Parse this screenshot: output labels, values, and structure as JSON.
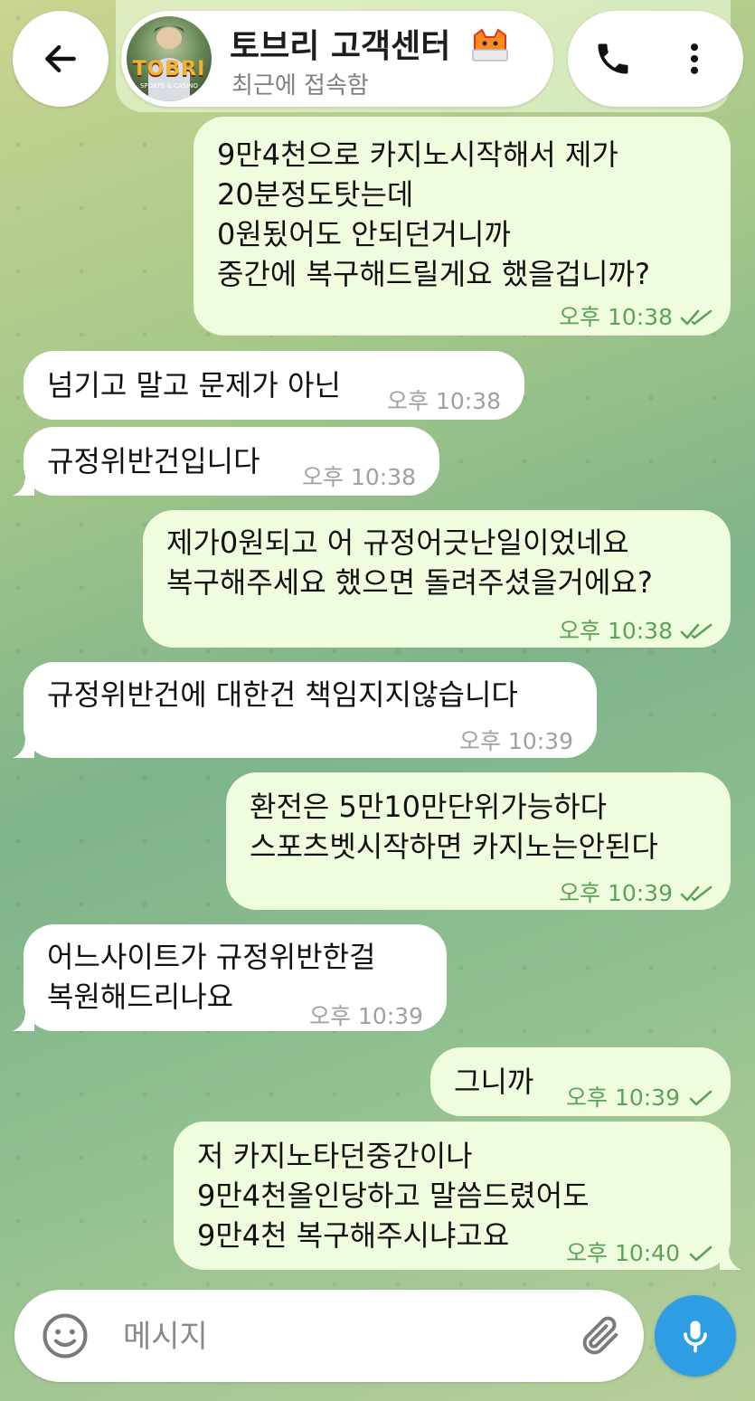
{
  "header": {
    "title": "토브리 고객센터",
    "status": "최근에 접속함",
    "avatar_text": "TOBRI",
    "avatar_sub": "SPORTS & CASINO"
  },
  "messages": [
    {
      "dir": "out",
      "lines": [
        "9만4천으로 카지노시작해서 제가",
        "20분정도탓는데",
        "0원됬어도 안되던거니까",
        "중간에 복구해드릴게요  했을겁니까?"
      ],
      "time": "오후 10:38",
      "status": "read"
    },
    {
      "dir": "in",
      "lines": [
        "넘기고 말고 문제가 아닌"
      ],
      "time": "오후 10:38"
    },
    {
      "dir": "in",
      "lines": [
        "규정위반건입니다"
      ],
      "time": "오후 10:38"
    },
    {
      "dir": "out",
      "lines": [
        "제가0원되고 어 규정어긋난일이었네요",
        "복구해주세요 했으면 돌려주셨을거에요?"
      ],
      "time": "오후 10:38",
      "status": "read"
    },
    {
      "dir": "in",
      "lines": [
        "규정위반건에 대한건 책임지지않습니다"
      ],
      "time": "오후 10:39"
    },
    {
      "dir": "out",
      "lines": [
        "환전은 5만10만단위가능하다",
        "스포츠벳시작하면 카지노는안된다"
      ],
      "time": "오후 10:39",
      "status": "read"
    },
    {
      "dir": "in",
      "lines": [
        "어느사이트가 규정위반한걸",
        "복원해드리나요"
      ],
      "time": "오후 10:39"
    },
    {
      "dir": "out",
      "lines": [
        "그니까"
      ],
      "time": "오후 10:39",
      "status": "sent"
    },
    {
      "dir": "out",
      "lines": [
        "저 카지노타던중간이나",
        "9만4천올인당하고 말씀드렸어도",
        "9만4천 복구해주시냐고요"
      ],
      "time": "오후 10:40",
      "status": "sent"
    }
  ],
  "input": {
    "placeholder": "메시지"
  },
  "icons": {
    "back": "arrow-left-icon",
    "call": "phone-icon",
    "more": "more-vertical-icon",
    "emoji": "smiley-icon",
    "attach": "paperclip-icon",
    "mic": "microphone-icon"
  },
  "colors": {
    "outgoing_bubble": "#effdde",
    "incoming_bubble": "#ffffff",
    "accent": "#2f9de4",
    "check": "#5aa25a"
  }
}
